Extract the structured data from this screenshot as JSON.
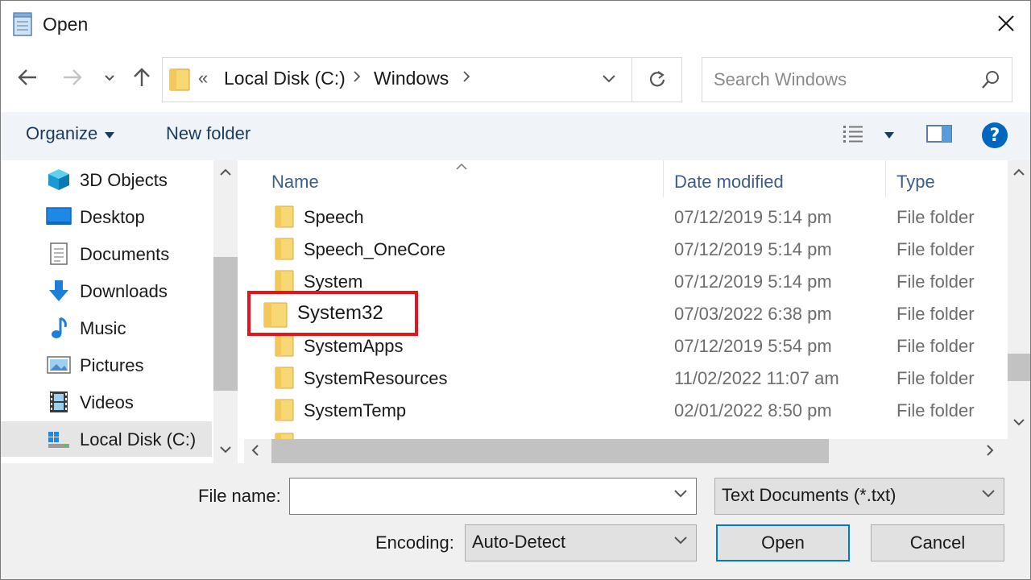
{
  "window": {
    "title": "Open"
  },
  "address": {
    "overflow_glyph": "«",
    "crumbs": [
      "Local Disk (C:)",
      "Windows"
    ]
  },
  "search": {
    "placeholder": "Search Windows"
  },
  "toolbar": {
    "organize_label": "Organize",
    "new_folder_label": "New folder",
    "help_glyph": "?"
  },
  "nav_pane": {
    "items": [
      {
        "label": "3D Objects",
        "icon": "3d-objects-icon"
      },
      {
        "label": "Desktop",
        "icon": "desktop-icon"
      },
      {
        "label": "Documents",
        "icon": "documents-icon"
      },
      {
        "label": "Downloads",
        "icon": "downloads-icon"
      },
      {
        "label": "Music",
        "icon": "music-icon"
      },
      {
        "label": "Pictures",
        "icon": "pictures-icon"
      },
      {
        "label": "Videos",
        "icon": "videos-icon"
      },
      {
        "label": "Local Disk (C:)",
        "icon": "local-disk-icon",
        "selected": true
      }
    ]
  },
  "file_list": {
    "columns": {
      "name": "Name",
      "date": "Date modified",
      "type": "Type"
    },
    "rows": [
      {
        "name": "Speech",
        "date": "07/12/2019 5:14 pm",
        "type": "File folder"
      },
      {
        "name": "Speech_OneCore",
        "date": "07/12/2019 5:14 pm",
        "type": "File folder"
      },
      {
        "name": "System",
        "date": "07/12/2019 5:14 pm",
        "type": "File folder"
      },
      {
        "name": "System32",
        "date": "07/03/2022 6:38 pm",
        "type": "File folder",
        "highlighted": true
      },
      {
        "name": "SystemApps",
        "date": "07/12/2019 5:54 pm",
        "type": "File folder"
      },
      {
        "name": "SystemResources",
        "date": "11/02/2022 11:07 am",
        "type": "File folder"
      },
      {
        "name": "SystemTemp",
        "date": "02/01/2022 8:50 pm",
        "type": "File folder"
      }
    ]
  },
  "bottom": {
    "file_name_label": "File name:",
    "file_name_value": "",
    "file_type_value": "Text Documents (*.txt)",
    "encoding_label": "Encoding:",
    "encoding_value": "Auto-Detect",
    "open_label": "Open",
    "cancel_label": "Cancel"
  },
  "colors": {
    "accent": "#0078d7",
    "highlight": "#e8141c",
    "folder": "#f8d775"
  }
}
